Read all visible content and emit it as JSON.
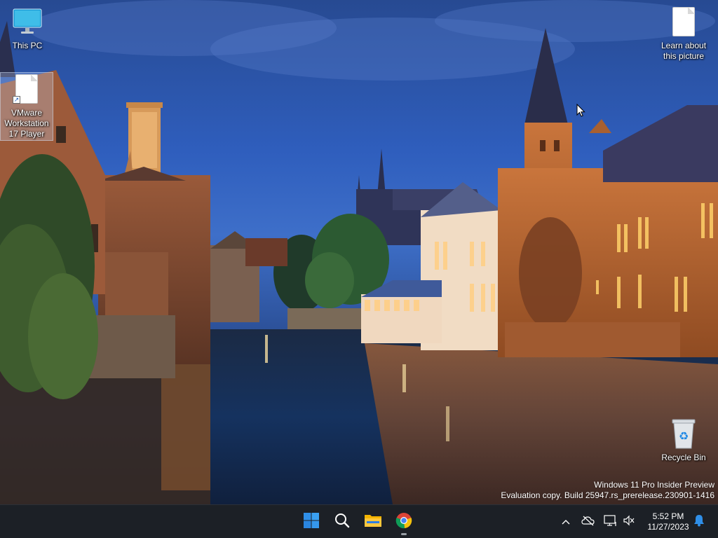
{
  "desktop": {
    "icons": [
      {
        "label": "This PC",
        "icon": "monitor-icon"
      },
      {
        "label": "VMware Workstation 17 Player",
        "icon": "file-shortcut-icon"
      },
      {
        "label": "Learn about this picture",
        "icon": "file-icon"
      },
      {
        "label": "Recycle Bin",
        "icon": "recycle-bin-icon"
      }
    ]
  },
  "watermark": {
    "line1": "Windows 11 Pro Insider Preview",
    "line2": "Evaluation copy. Build 25947.rs_prerelease.230901-1416"
  },
  "taskbar": {
    "apps": [
      {
        "name": "Start",
        "icon": "windows-start-icon"
      },
      {
        "name": "Search",
        "icon": "search-icon"
      },
      {
        "name": "File Explorer",
        "icon": "folder-icon"
      },
      {
        "name": "Google Chrome",
        "icon": "chrome-icon",
        "running": true
      }
    ],
    "tray": {
      "icons": [
        "chevron-up-icon",
        "no-network-icon",
        "network-display-icon",
        "volume-muted-icon",
        "notification-bell-icon"
      ],
      "time": "5:52 PM",
      "date": "11/27/2023"
    }
  },
  "colors": {
    "taskbar_bg": "#1c2026",
    "start_blue": "#2f8fe8",
    "folder_yellow": "#f4b400"
  }
}
